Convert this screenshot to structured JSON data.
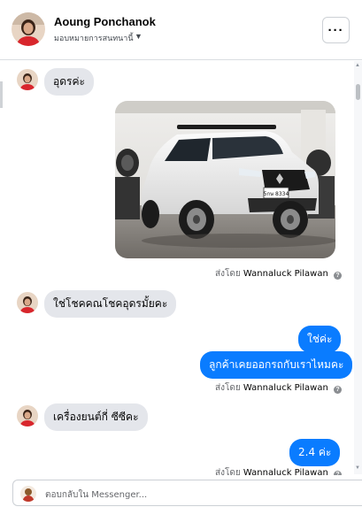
{
  "header": {
    "contact_name": "Aoung Ponchanok",
    "subtitle": "มอบหมายการสนทนานี้",
    "more_label": "···"
  },
  "messages": [
    {
      "id": "m1",
      "direction": "incoming",
      "text": "อุดรค่ะ"
    },
    {
      "id": "m2",
      "direction": "outgoing",
      "type": "image",
      "sent_by_prefix": "ส่งโดย",
      "sent_by_name": "Wannaluck Pilawan"
    },
    {
      "id": "m3",
      "direction": "incoming",
      "text": "ใช่โชคคณโชคอุดรมั้ยคะ"
    },
    {
      "id": "m4",
      "direction": "outgoing",
      "text": "ใช่ค่ะ"
    },
    {
      "id": "m5",
      "direction": "outgoing",
      "text": "ลูกค้าเคยออกรถกับเราไหมคะ",
      "sent_by_prefix": "ส่งโดย",
      "sent_by_name": "Wannaluck Pilawan"
    },
    {
      "id": "m6",
      "direction": "incoming",
      "text": "เครื่องยนต์กี่ ซีซีคะ"
    },
    {
      "id": "m7",
      "direction": "outgoing",
      "text": "2.4  ค่ะ",
      "sent_by_prefix": "ส่งโดย",
      "sent_by_name": "Wannaluck Pilawan"
    }
  ],
  "composer": {
    "placeholder": "ตอบกลับใน Messenger..."
  },
  "photo": {
    "plate_text": "5กษ 8334"
  },
  "colors": {
    "outgoing_bubble": "#0a7cff",
    "incoming_bubble": "#e4e6eb",
    "border": "#ccd0d5"
  }
}
